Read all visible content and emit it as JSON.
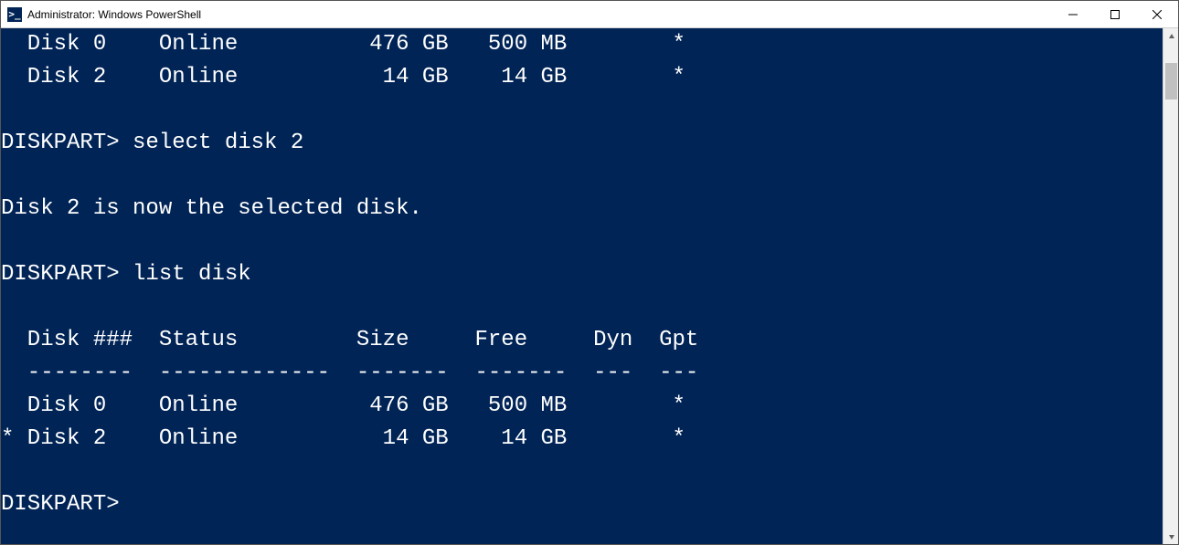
{
  "window": {
    "title": "Administrator: Windows PowerShell",
    "icon_glyph": ">_"
  },
  "terminal": {
    "lines": [
      "  Disk 0    Online          476 GB   500 MB        *",
      "  Disk 2    Online           14 GB    14 GB        *",
      "",
      "DISKPART> select disk 2",
      "",
      "Disk 2 is now the selected disk.",
      "",
      "DISKPART> list disk",
      "",
      "  Disk ###  Status         Size     Free     Dyn  Gpt",
      "  --------  -------------  -------  -------  ---  ---",
      "  Disk 0    Online          476 GB   500 MB        *",
      "* Disk 2    Online           14 GB    14 GB        *",
      "",
      "DISKPART>"
    ]
  }
}
